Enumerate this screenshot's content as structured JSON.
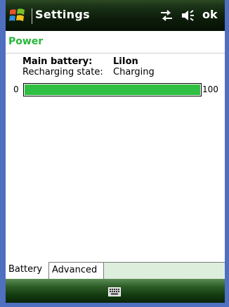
{
  "window": {
    "title": "Settings",
    "ok_label": "ok",
    "start_icon": "windows-flag-icon",
    "connectivity_icon": "connectivity-icon",
    "volume_icon": "volume-icon"
  },
  "page": {
    "heading": "Power"
  },
  "battery": {
    "main_label": "Main battery:",
    "main_value": "LiIon",
    "state_label": "Recharging state:",
    "state_value": "Charging",
    "level_min": "0",
    "level_max": "100",
    "level_percent": 100
  },
  "tabs": [
    {
      "label": "Battery",
      "selected": true
    },
    {
      "label": "Advanced",
      "selected": false
    }
  ],
  "bottom": {
    "keyboard_icon": "keyboard-icon"
  },
  "colors": {
    "heading": "#27b83a",
    "progress_fill": "#2fbf42",
    "frame": "#4f6fc0"
  }
}
